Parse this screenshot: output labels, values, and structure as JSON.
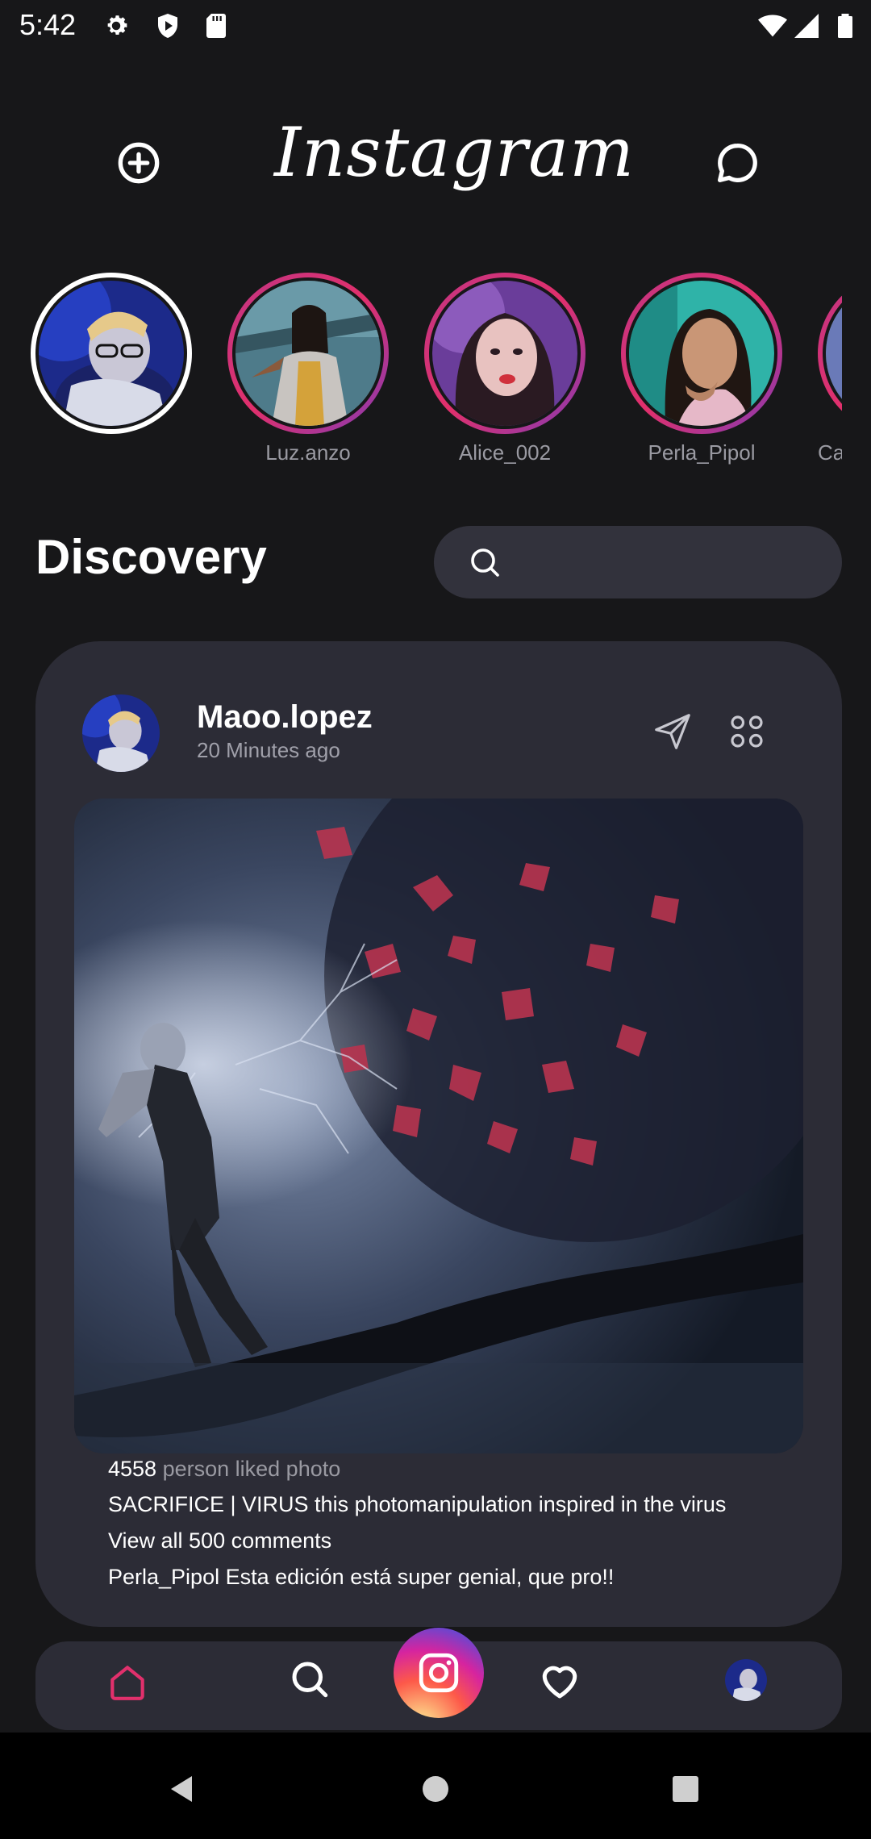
{
  "status_bar": {
    "time": "5:42"
  },
  "header": {
    "logo_text": "Instagram"
  },
  "stories": [
    {
      "name": "",
      "is_self": true
    },
    {
      "name": "Luz.anzo",
      "is_self": false
    },
    {
      "name": "Alice_002",
      "is_self": false
    },
    {
      "name": "Perla_Pipol",
      "is_self": false
    },
    {
      "name": "Ca",
      "is_self": false
    }
  ],
  "discovery": {
    "title": "Discovery",
    "search_placeholder": ""
  },
  "post": {
    "username": "Maoo.lopez",
    "time_ago": "20 Minutes ago",
    "likes_count": "4558",
    "likes_suffix": "person liked photo",
    "caption": "SACRIFICE | VIRUS this photomanipulation inspired in the virus",
    "view_comments": "View all 500 comments",
    "comment_user": "Perla_Pipol",
    "comment_text": "Esta edición está super genial, que pro!!"
  },
  "bottom_nav": {
    "items": [
      "home-icon",
      "search-icon",
      "camera-icon",
      "heart-icon",
      "profile-avatar"
    ],
    "active": "home-icon"
  },
  "colors": {
    "accent": "#e1306c",
    "card": "#2c2c36",
    "background": "#171719"
  }
}
